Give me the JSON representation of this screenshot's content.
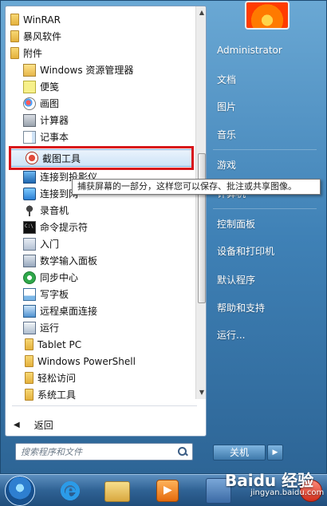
{
  "programs": [
    {
      "label": "WinRAR",
      "icon": "folder-icon"
    },
    {
      "label": "暴风软件",
      "icon": "folder-icon"
    },
    {
      "label": "附件",
      "icon": "folder-icon"
    },
    {
      "label": "Windows 资源管理器",
      "icon": "explorer-icon"
    },
    {
      "label": "便笺",
      "icon": "sticky-note-icon"
    },
    {
      "label": "画图",
      "icon": "paint-icon"
    },
    {
      "label": "计算器",
      "icon": "calculator-icon"
    },
    {
      "label": "记事本",
      "icon": "notepad-icon"
    },
    {
      "label": "截图工具",
      "icon": "snipping-tool-icon"
    },
    {
      "label": "连接到投影仪",
      "icon": "projector-icon"
    },
    {
      "label": "连接到网",
      "icon": "network-icon"
    },
    {
      "label": "录音机",
      "icon": "microphone-icon"
    },
    {
      "label": "命令提示符",
      "icon": "command-prompt-icon"
    },
    {
      "label": "入门",
      "icon": "getting-started-icon"
    },
    {
      "label": "数学输入面板",
      "icon": "math-input-icon"
    },
    {
      "label": "同步中心",
      "icon": "sync-center-icon"
    },
    {
      "label": "写字板",
      "icon": "wordpad-icon"
    },
    {
      "label": "远程桌面连接",
      "icon": "remote-desktop-icon"
    },
    {
      "label": "运行",
      "icon": "run-icon"
    },
    {
      "label": "Tablet PC",
      "icon": "folder-icon"
    },
    {
      "label": "Windows PowerShell",
      "icon": "folder-icon"
    },
    {
      "label": "轻松访问",
      "icon": "folder-icon"
    },
    {
      "label": "系统工具",
      "icon": "folder-icon"
    }
  ],
  "tooltip": "捕获屏幕的一部分，这样您可以保存、批注或共享图像。",
  "back_label": "返回",
  "search_placeholder": "搜索程序和文件",
  "right_pane": {
    "username": "Administrator",
    "items": [
      "文档",
      "图片",
      "音乐",
      "游戏",
      "计算机",
      "控制面板",
      "设备和打印机",
      "默认程序",
      "帮助和支持",
      "运行..."
    ]
  },
  "shutdown_label": "关机",
  "shutdown_arrow": "▶",
  "watermark": {
    "brand": "Baidu 经验",
    "url": "jingyan.baidu.com"
  },
  "colors": {
    "highlight_border": "#d8141a",
    "start_menu_blue": "#3f81b6"
  }
}
